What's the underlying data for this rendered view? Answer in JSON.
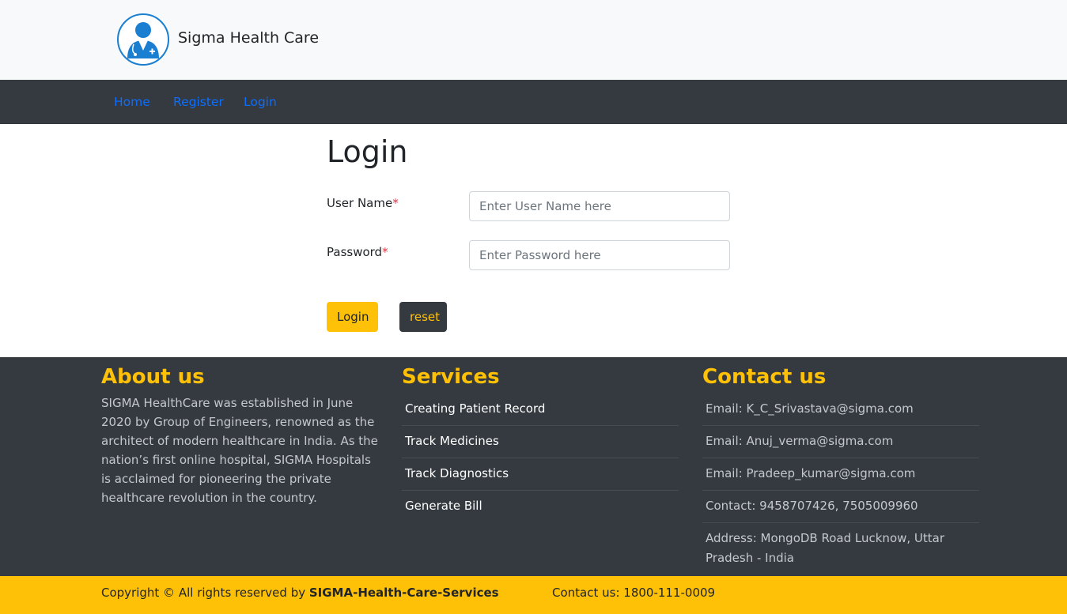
{
  "brand": {
    "name": "Sigma Health Care",
    "logo_icon": "doctor-icon"
  },
  "nav": {
    "items": [
      {
        "label": "Home"
      },
      {
        "label": "Register"
      },
      {
        "label": "Login"
      }
    ]
  },
  "login": {
    "title": "Login",
    "username_label": "User Name",
    "username_placeholder": "Enter User Name here",
    "password_label": "Password",
    "password_placeholder": "Enter Password here",
    "required_marker": "*",
    "login_button": "Login",
    "reset_button": "reset"
  },
  "footer": {
    "about": {
      "title": "About us",
      "text": "SIGMA HealthCare was established in June 2020 by Group of Engineers, renowned as the architect of modern healthcare in India. As the nation’s first online hospital, SIGMA Hospitals is acclaimed for pioneering the private healthcare revolution in the country."
    },
    "services": {
      "title": "Services",
      "items": [
        {
          "label": "Creating Patient Record"
        },
        {
          "label": "Track Medicines"
        },
        {
          "label": "Track Diagnostics"
        },
        {
          "label": "Generate Bill"
        }
      ]
    },
    "contact": {
      "title": "Contact us",
      "items": [
        {
          "label": "Email: K_C_Srivastava@sigma.com"
        },
        {
          "label": "Email: Anuj_verma@sigma.com"
        },
        {
          "label": "Email: Pradeep_kumar@sigma.com"
        },
        {
          "label": "Contact: 9458707426, 7505009960"
        },
        {
          "label": "Address: MongoDB Road Lucknow, Uttar Pradesh - India"
        }
      ]
    }
  },
  "bottom": {
    "copyright_prefix": "Copyright © All rights reserved by ",
    "copyright_brand": "SIGMA-Health-Care-Services",
    "contact": "Contact us: 1800-111-0009"
  },
  "colors": {
    "accent": "#ffc107",
    "dark": "#343a40",
    "link": "#0d6efd",
    "required": "#dc3545",
    "logo": "#1a7fd1"
  }
}
